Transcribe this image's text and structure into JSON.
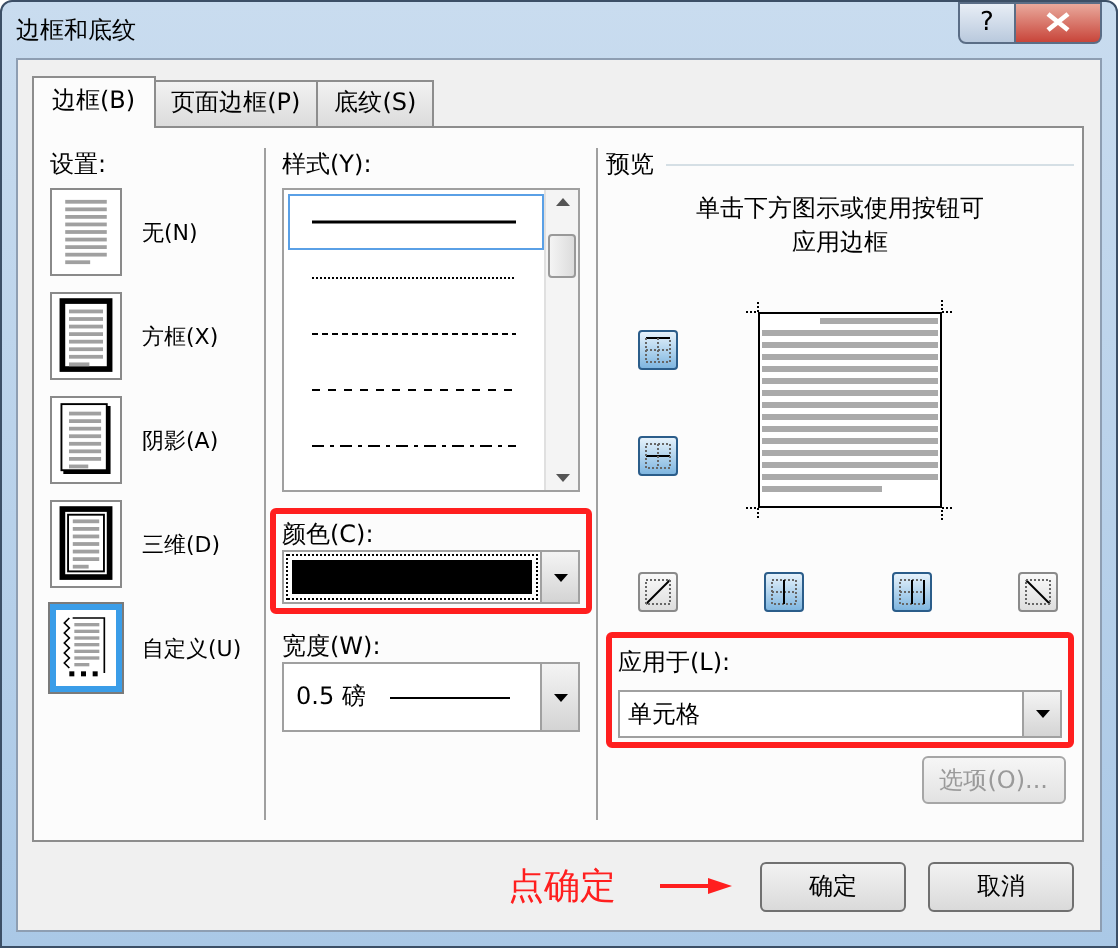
{
  "window": {
    "title": "边框和底纹",
    "help": "?"
  },
  "tabs": [
    {
      "label": "边框(B)",
      "selected": true
    },
    {
      "label": "页面边框(P)",
      "selected": false
    },
    {
      "label": "底纹(S)",
      "selected": false
    }
  ],
  "settings": {
    "label": "设置:",
    "items": [
      {
        "kind": "none",
        "label": "无(N)",
        "selected": false
      },
      {
        "kind": "box",
        "label": "方框(X)",
        "selected": false
      },
      {
        "kind": "shadow",
        "label": "阴影(A)",
        "selected": false
      },
      {
        "kind": "threed",
        "label": "三维(D)",
        "selected": false
      },
      {
        "kind": "custom",
        "label": "自定义(U)",
        "selected": true
      }
    ]
  },
  "style": {
    "label": "样式(Y):",
    "items": [
      {
        "kind": "solid",
        "selected": true
      },
      {
        "kind": "dotted",
        "selected": false
      },
      {
        "kind": "dashed",
        "selected": false
      },
      {
        "kind": "dashed-wide",
        "selected": false
      },
      {
        "kind": "dash-dot",
        "selected": false
      }
    ]
  },
  "color": {
    "label": "颜色(C):",
    "color": "#000000",
    "highlighted": true
  },
  "width": {
    "label": "宽度(W):",
    "value": "0.5 磅"
  },
  "preview": {
    "label": "预览",
    "hint": "单击下方图示或使用按钮可应用边框",
    "side_buttons": [
      {
        "kind": "top",
        "selected": true
      },
      {
        "kind": "inside-horizontal",
        "selected": true
      }
    ],
    "bottom_buttons": [
      {
        "kind": "diagonal-up",
        "selected": false
      },
      {
        "kind": "left",
        "selected": true
      },
      {
        "kind": "inside-vertical",
        "selected": true
      },
      {
        "kind": "diagonal-down",
        "selected": false
      }
    ]
  },
  "apply_to": {
    "label": "应用于(L):",
    "value": "单元格",
    "highlighted": true
  },
  "options_button": {
    "label": "选项(O)...",
    "disabled": true
  },
  "annotation": {
    "text": "点确定"
  },
  "buttons": [
    {
      "label": "确定"
    },
    {
      "label": "取消"
    }
  ]
}
